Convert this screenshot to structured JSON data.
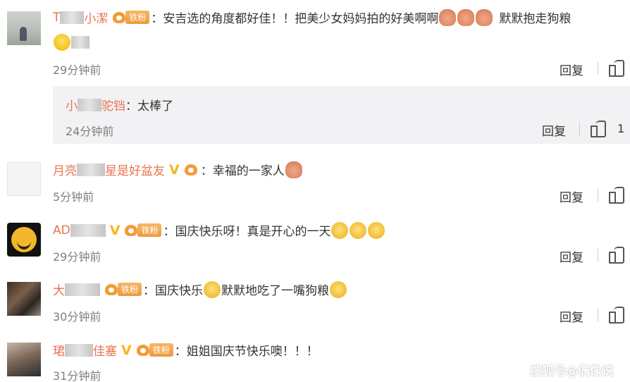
{
  "comments": [
    {
      "name_left": "T",
      "name_right": "小潔",
      "fan_label": "铁粉",
      "fan_level": "5",
      "text": "：安吉选的角度都好佳！！把美少女妈妈拍的好美啊啊",
      "text_tail": "默默抱走狗粮",
      "time": "29分钟前",
      "reply_label": "回复"
    },
    {
      "name_left": "月亮",
      "name_right": "星是好盆友",
      "fan_label": "铁粉",
      "fan_level": "5",
      "text": "：幸福的一家人",
      "time": "5分钟前",
      "reply_label": "回复"
    },
    {
      "name_left": "AD",
      "name_right": "",
      "fan_label": "铁粉",
      "fan_level": "4",
      "text": "：国庆快乐呀！真是开心的一天",
      "time": "29分钟前",
      "reply_label": "回复"
    },
    {
      "name_left": "大",
      "name_right": "",
      "fan_label": "铁粉",
      "fan_level": "4",
      "text": "：国庆快乐",
      "text_tail": "默默地吃了一嘴狗粮",
      "time": "30分钟前",
      "reply_label": "回复"
    },
    {
      "name_left": "珺",
      "name_right": "佳塞",
      "fan_label": "铁粉",
      "fan_level": "4",
      "text": "：姐姐国庆节快乐噢！！！",
      "time": "31分钟前"
    }
  ],
  "sub_reply": {
    "name_left": "小",
    "name_right": "驼铛",
    "text": "：太棒了",
    "time": "24分钟前",
    "reply_label": "回复",
    "like_count": "1"
  },
  "watermark": "搜狐号@偶像说",
  "colors": {
    "name": "#eb7350",
    "fan_pill": "#ee9a3d",
    "vip": "#f5b724",
    "reply_bg": "#f2f2f5"
  }
}
